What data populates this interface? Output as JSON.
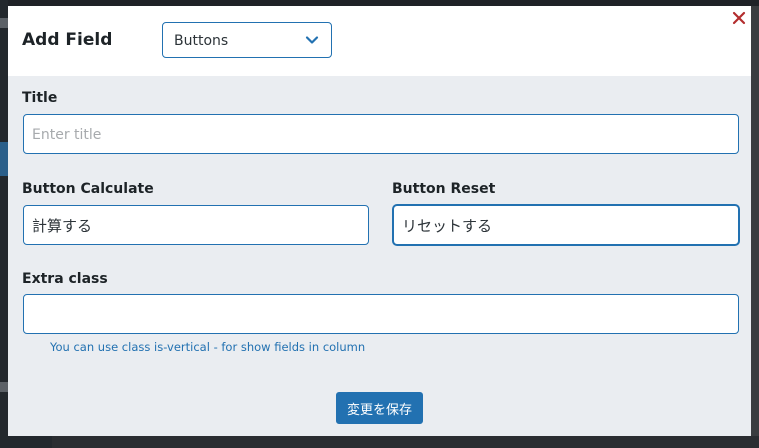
{
  "header": {
    "title": "Add Field",
    "field_type": {
      "selected": "Buttons",
      "icon": "chevron-down-icon"
    },
    "close_icon": "close-icon"
  },
  "form": {
    "title": {
      "label": "Title",
      "value": "",
      "placeholder": "Enter title"
    },
    "button_calculate": {
      "label": "Button Calculate",
      "value": "計算する"
    },
    "button_reset": {
      "label": "Button Reset",
      "value": "リセットする"
    },
    "extra_class": {
      "label": "Extra class",
      "value": "",
      "hint": "You can use class is-vertical - for show fields in column"
    }
  },
  "footer": {
    "save_label": "変更を保存"
  },
  "colors": {
    "accent": "#2271b1",
    "close": "#b32d2e",
    "panel": "#eaedf1"
  }
}
